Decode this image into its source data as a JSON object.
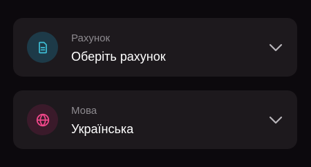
{
  "account_select": {
    "caption": "Рахунок",
    "value": "Оберіть рахунок",
    "icon": "document-icon",
    "icon_color": "#3fc1d9",
    "icon_bg": "#1d3a48"
  },
  "language_select": {
    "caption": "Мова",
    "value": "Українська",
    "icon": "globe-icon",
    "icon_color": "#f0478a",
    "icon_bg": "#3a1a2a"
  },
  "colors": {
    "background": "#0c090d",
    "card": "#1d191d",
    "caption": "#8d8a8f",
    "value": "#ffffff",
    "chevron": "#b9b6bb"
  }
}
